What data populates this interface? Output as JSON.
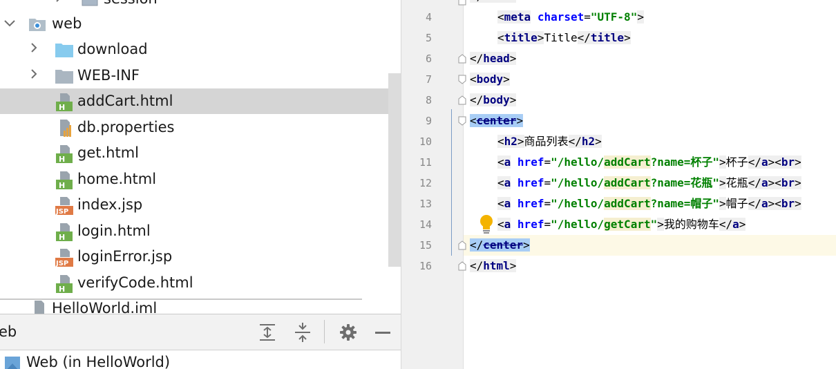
{
  "project_tree": {
    "items": [
      {
        "label": "session",
        "icon": "package-icon",
        "expandable": true,
        "expanded": false
      },
      {
        "label": "web",
        "icon": "web-module-folder-icon",
        "expandable": true,
        "expanded": true
      },
      {
        "label": "download",
        "icon": "folder-icon",
        "expandable": true,
        "expanded": false
      },
      {
        "label": "WEB-INF",
        "icon": "folder-icon",
        "expandable": true,
        "expanded": false
      },
      {
        "label": "addCart.html",
        "icon": "html-file-icon",
        "selected": true
      },
      {
        "label": "db.properties",
        "icon": "properties-file-icon"
      },
      {
        "label": "get.html",
        "icon": "html-file-icon"
      },
      {
        "label": "home.html",
        "icon": "html-file-icon"
      },
      {
        "label": "index.jsp",
        "icon": "jsp-file-icon"
      },
      {
        "label": "login.html",
        "icon": "html-file-icon"
      },
      {
        "label": "loginError.jsp",
        "icon": "jsp-file-icon"
      },
      {
        "label": "verifyCode.html",
        "icon": "html-file-icon"
      },
      {
        "label": "HelloWorld.iml",
        "icon": "module-file-icon"
      }
    ],
    "html_badge": "H",
    "jsp_badge": "JSP"
  },
  "bottom_panel": {
    "title": "eb",
    "services_item": "Web (in HelloWorld)",
    "buttons": [
      "expand-all-icon",
      "collapse-all-icon",
      "gear-icon",
      "minimize-icon"
    ]
  },
  "editor": {
    "line_numbers": [
      "4",
      "5",
      "6",
      "7",
      "8",
      "9",
      "10",
      "11",
      "12",
      "13",
      "14",
      "15",
      "16"
    ],
    "current_line": "15",
    "code": {
      "l3": "head",
      "l4": {
        "tag": "meta",
        "attr": "charset",
        "val": "\"UTF-8\""
      },
      "l5": {
        "tag": "title",
        "text": "Title"
      },
      "l6": {
        "tag": "head"
      },
      "l7": {
        "tag": "body"
      },
      "l8": {
        "tag": "body"
      },
      "l9": {
        "tag": "center"
      },
      "l10": {
        "tag": "h2",
        "text": "商品列表"
      },
      "l11": {
        "href_a": "\"/hello/",
        "href_b": "addCart",
        "href_c": "?name=杯子\"",
        "text": "杯子"
      },
      "l12": {
        "href_a": "\"/hello/",
        "href_b": "addCart",
        "href_c": "?name=花瓶\"",
        "text": "花瓶"
      },
      "l13": {
        "href_a": "\"/hello/",
        "href_b": "addCart",
        "href_c": "?name=帽子\"",
        "text": "帽子"
      },
      "l14": {
        "href_a": "\"/hello/",
        "href_b": "getCart",
        "href_c": "\"",
        "text": "我的购物车"
      },
      "l15": {
        "tag": "center"
      },
      "l16": {
        "tag": "html"
      },
      "a_tag": "a",
      "br_tag": "br",
      "href_attr": "href"
    },
    "colors": {
      "tag": "#000080",
      "attr": "#0000ff",
      "string": "#008000",
      "caret_line": "#fdf9e6",
      "match_highlight": "#a8cdf5"
    }
  }
}
